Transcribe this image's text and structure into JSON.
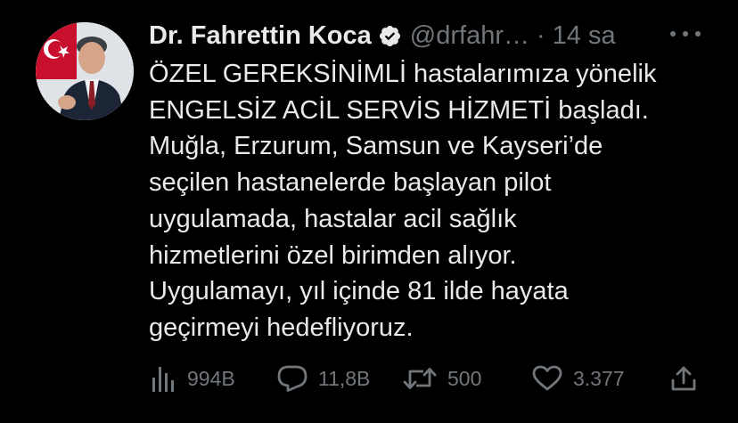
{
  "tweet": {
    "author": {
      "display_name": "Dr. Fahrettin Koca",
      "handle": "@drfahr…",
      "verified": true
    },
    "separator": "·",
    "timestamp": "14 sa",
    "text_lines": [
      "ÖZEL GEREKSİNİMLİ hastalarımıza yönelik",
      "ENGELSİZ ACİL SERVİS HİZMETİ başladı.",
      "Muğla, Erzurum, Samsun ve Kayseri’de",
      "seçilen hastanelerde başlayan pilot",
      "uygulamada, hastalar acil sağlık",
      "hizmetlerini özel birimden alıyor.",
      "Uygulamayı, yıl içinde 81 ilde hayata",
      "geçirmeyi hedefliyoruz."
    ]
  },
  "actions": {
    "views": "994B",
    "replies": "11,8B",
    "retweets": "500",
    "likes": "3.377"
  },
  "icons": {
    "views": "bar-chart-icon",
    "reply": "reply-icon",
    "retweet": "retweet-icon",
    "like": "heart-icon",
    "share": "share-icon",
    "more": "more-icon",
    "verified": "verified-badge-icon"
  },
  "colors": {
    "background": "#000000",
    "primary_text": "#e7e9ea",
    "secondary_text": "#71767b",
    "verified_badge": "#e7e9ea"
  }
}
